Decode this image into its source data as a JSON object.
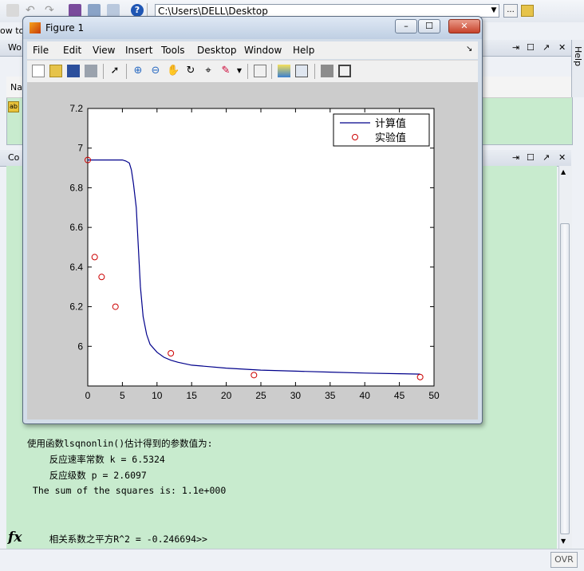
{
  "main_toolbar": {
    "current_folder": "C:\\Users\\DELL\\Desktop",
    "browse_label": "..."
  },
  "shortcuts": {
    "partial_label": "ow to"
  },
  "workspace": {
    "partial_header": "Wo",
    "partial_column": "Na"
  },
  "command_window": {
    "partial_header": "Co",
    "lines": [
      "使用函数lsqnonlin()估计得到的参数值为:",
      "    反应速率常数 k = 6.5324",
      "    反应级数 p = 2.6097",
      " The sum of the squares is: 1.1e+000",
      "    相关系数之平方R^2 = -0.246694>>"
    ],
    "fx_label": "fx"
  },
  "help_panel": {
    "label": "Help"
  },
  "status_bar": {
    "ovr_label": "OVR"
  },
  "figure": {
    "title": "Figure 1",
    "menu": [
      "File",
      "Edit",
      "View",
      "Insert",
      "Tools",
      "Desktop",
      "Window",
      "Help"
    ]
  },
  "chart_data": {
    "type": "line",
    "title": "",
    "xlabel": "",
    "ylabel": "",
    "xlim": [
      0,
      50
    ],
    "ylim": [
      5.8,
      7.2
    ],
    "xticks": [
      0,
      5,
      10,
      15,
      20,
      25,
      30,
      35,
      40,
      45,
      50
    ],
    "yticks": [
      6,
      6.2,
      6.4,
      6.6,
      6.8,
      7,
      7.2
    ],
    "grid": false,
    "legend": "top-right",
    "series": [
      {
        "name": "计算值",
        "style": "line",
        "color": "#00008b",
        "x": [
          0,
          2,
          4,
          5,
          5.5,
          6,
          6.3,
          6.6,
          7,
          7.3,
          7.6,
          8,
          8.5,
          9,
          10,
          11,
          12,
          13,
          15,
          20,
          25,
          30,
          35,
          40,
          45,
          48
        ],
        "y": [
          6.94,
          6.94,
          6.94,
          6.94,
          6.935,
          6.925,
          6.89,
          6.82,
          6.7,
          6.5,
          6.3,
          6.15,
          6.06,
          6.01,
          5.97,
          5.945,
          5.93,
          5.92,
          5.905,
          5.89,
          5.88,
          5.875,
          5.87,
          5.865,
          5.862,
          5.86
        ]
      },
      {
        "name": "实验值",
        "style": "marker",
        "color": "#cc0000",
        "x": [
          0,
          1,
          2,
          4,
          12,
          24,
          48
        ],
        "y": [
          6.94,
          6.45,
          6.35,
          6.2,
          5.965,
          5.855,
          5.845
        ]
      }
    ]
  }
}
